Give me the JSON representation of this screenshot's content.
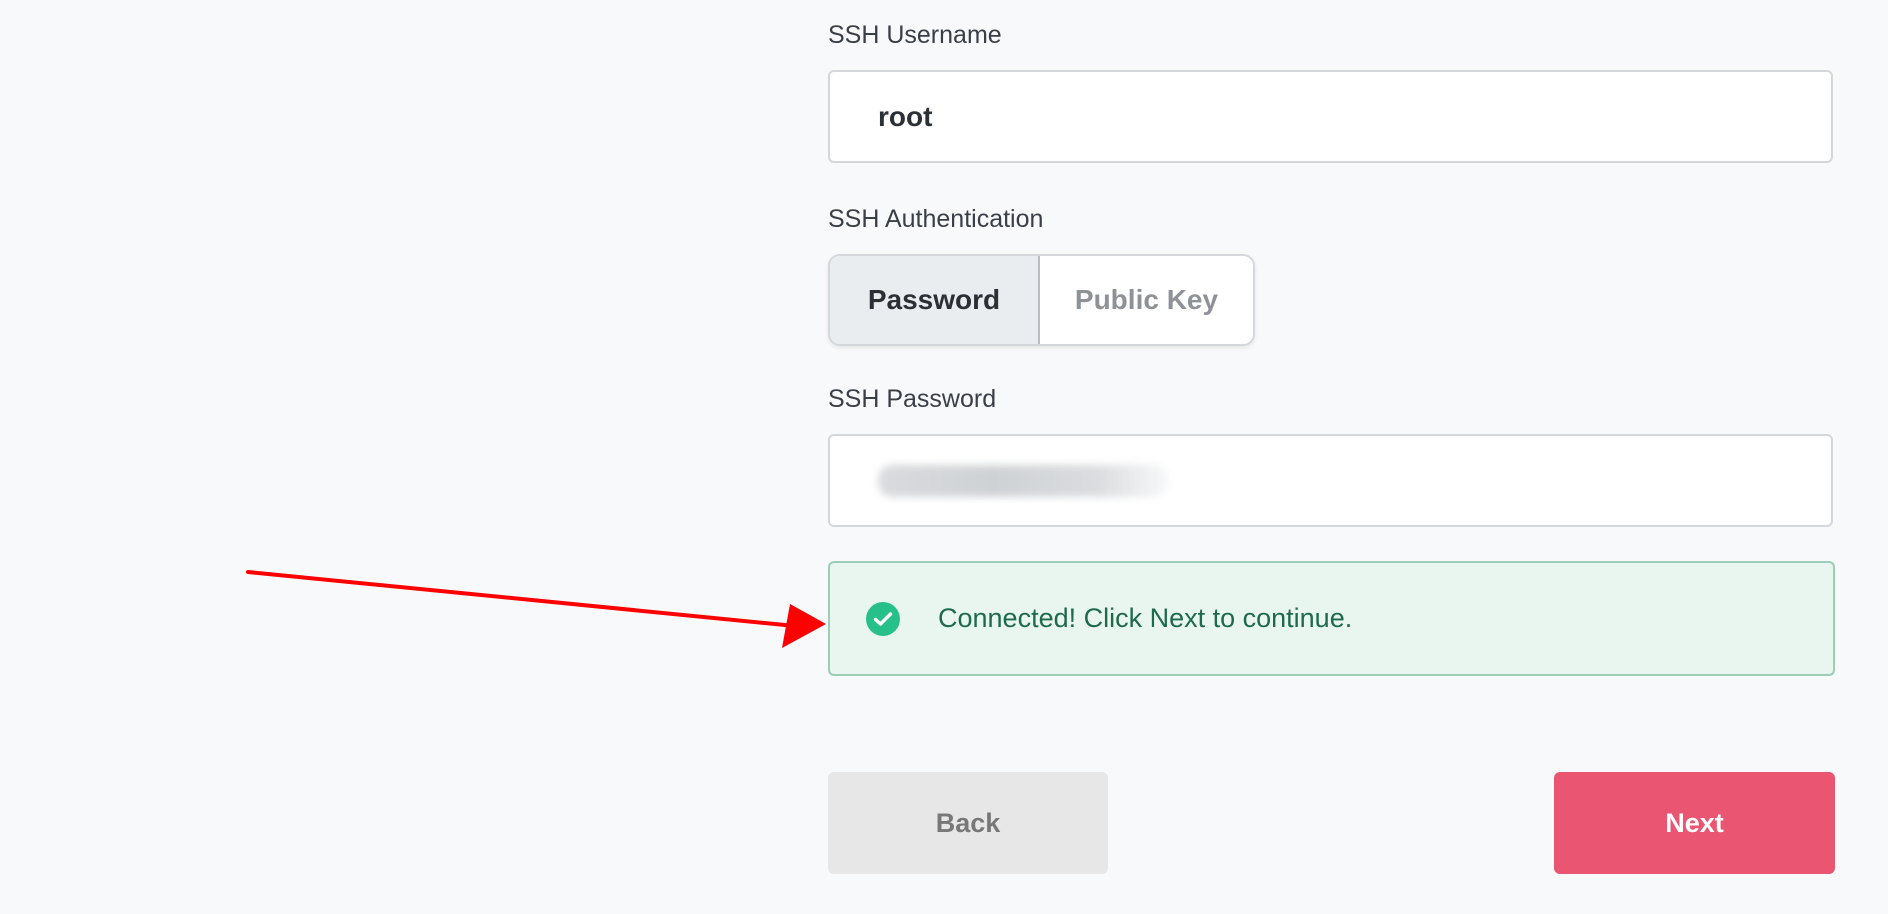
{
  "form": {
    "username": {
      "label": "SSH Username",
      "value": "root"
    },
    "auth": {
      "label": "SSH Authentication",
      "options": [
        "Password",
        "Public Key"
      ],
      "selected": "Password"
    },
    "password": {
      "label": "SSH Password",
      "value_state": "masked / blurred"
    },
    "status": {
      "message": "Connected! Click Next to continue.",
      "type": "success"
    },
    "buttons": {
      "back": "Back",
      "next": "Next"
    }
  },
  "annotation": {
    "arrow_color": "#ff0000"
  },
  "colors": {
    "success_bg": "#e9f6ef",
    "success_text": "#1e6a4c",
    "success_icon": "#27c08a",
    "primary": "#ea5571",
    "secondary": "#e7e7e7"
  },
  "icons": {
    "status": "check-circle-icon"
  }
}
